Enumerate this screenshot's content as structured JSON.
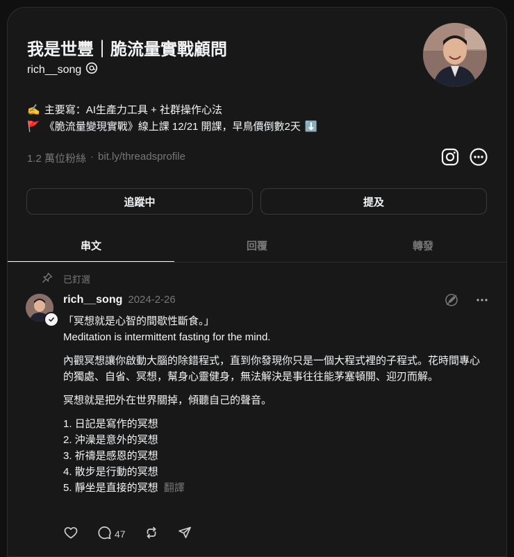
{
  "profile": {
    "name": "我是世豐｜脆流量實戰顧問",
    "handle": "rich__song",
    "bio_line1_emoji": "✍️",
    "bio_line1": "主要寫：AI生產力工具 + 社群操作心法",
    "bio_line2_emoji": "🚩",
    "bio_line2": "《脆流量變現實戰》線上課 12/21 開課，早鳥價倒數2天",
    "bio_line2_end_emoji": "⬇️",
    "followers": "1.2 萬位粉絲",
    "separator": "·",
    "link": "bit.ly/threadsprofile"
  },
  "buttons": {
    "following": "追蹤中",
    "mention": "提及"
  },
  "tabs": [
    {
      "label": "串文",
      "active": true
    },
    {
      "label": "回覆",
      "active": false
    },
    {
      "label": "轉發",
      "active": false
    }
  ],
  "pinned_label": "已釘選",
  "post": {
    "username": "rich__song",
    "date": "2024-2-26",
    "paragraph1_line1": "「冥想就是心智的間歇性斷食。」",
    "paragraph1_line2": "Meditation is intermittent fasting for the mind.",
    "paragraph2": "內觀冥想讓你啟動大腦的除錯程式，直到你發現你只是一個大程式裡的子程式。花時間專心的獨處、自省、冥想，幫身心靈健身，無法解決是事往往能茅塞頓開、迎刃而解。",
    "paragraph3": "冥想就是把外在世界關掉，傾聽自己的聲音。",
    "list": [
      "1. 日記是寫作的冥想",
      "2. 沖澡是意外的冥想",
      "3. 祈禱是感恩的冥想",
      "4. 散步是行動的冥想",
      "5. 靜坐是直接的冥想"
    ],
    "translate": "翻譯",
    "reply_count": "47"
  },
  "icons": {
    "threads_badge": "threads-badge-icon",
    "instagram": "instagram-icon",
    "more": "more-circle-icon",
    "pin": "pin-icon",
    "verified": "verified-check-icon",
    "edit_off": "edit-off-icon",
    "post_more": "ellipsis-icon",
    "like": "heart-icon",
    "reply": "comment-icon",
    "repost": "repost-icon",
    "share": "send-icon"
  },
  "colors": {
    "background": "#101010",
    "panel": "#181818",
    "text": "#f3f5f7",
    "muted": "#777777",
    "border": "#2d2d2d"
  }
}
